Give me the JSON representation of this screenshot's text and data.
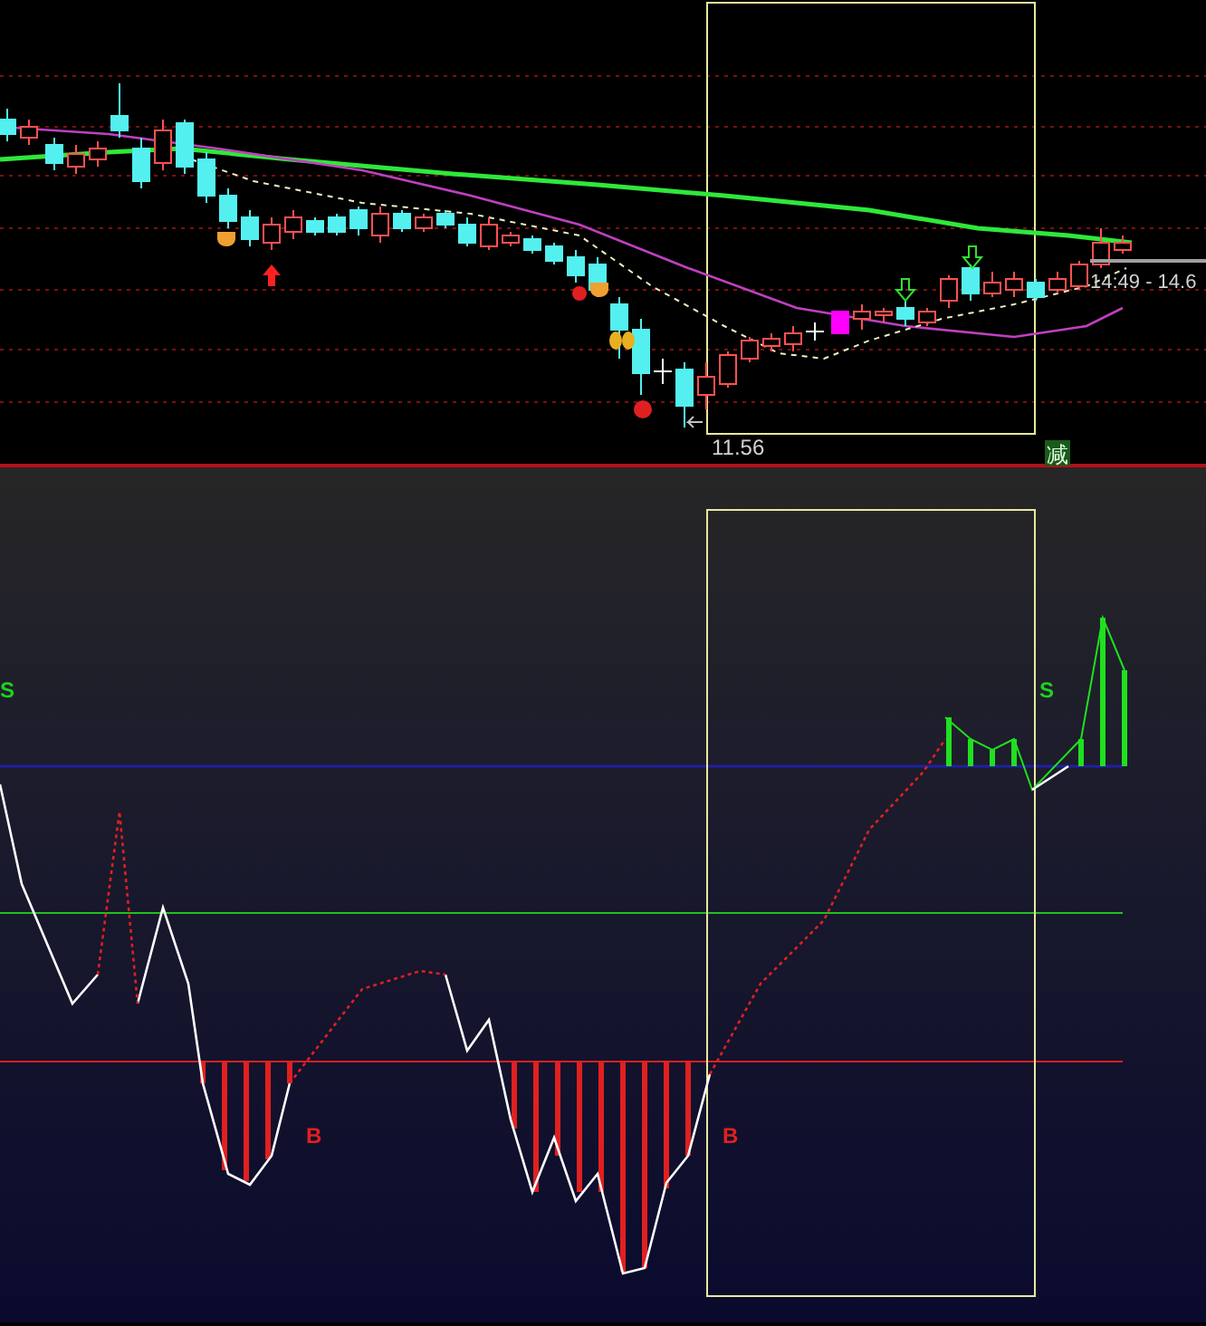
{
  "price_panel": {
    "low_label": "11.56",
    "time_range_label": "14:49 - 14.6",
    "signal_mark": "减"
  },
  "indicator_panel": {
    "signals": [
      {
        "kind": "sell",
        "text": "S"
      },
      {
        "kind": "sell",
        "text": "S"
      },
      {
        "kind": "buy",
        "text": "B"
      },
      {
        "kind": "buy",
        "text": "B"
      }
    ]
  }
}
